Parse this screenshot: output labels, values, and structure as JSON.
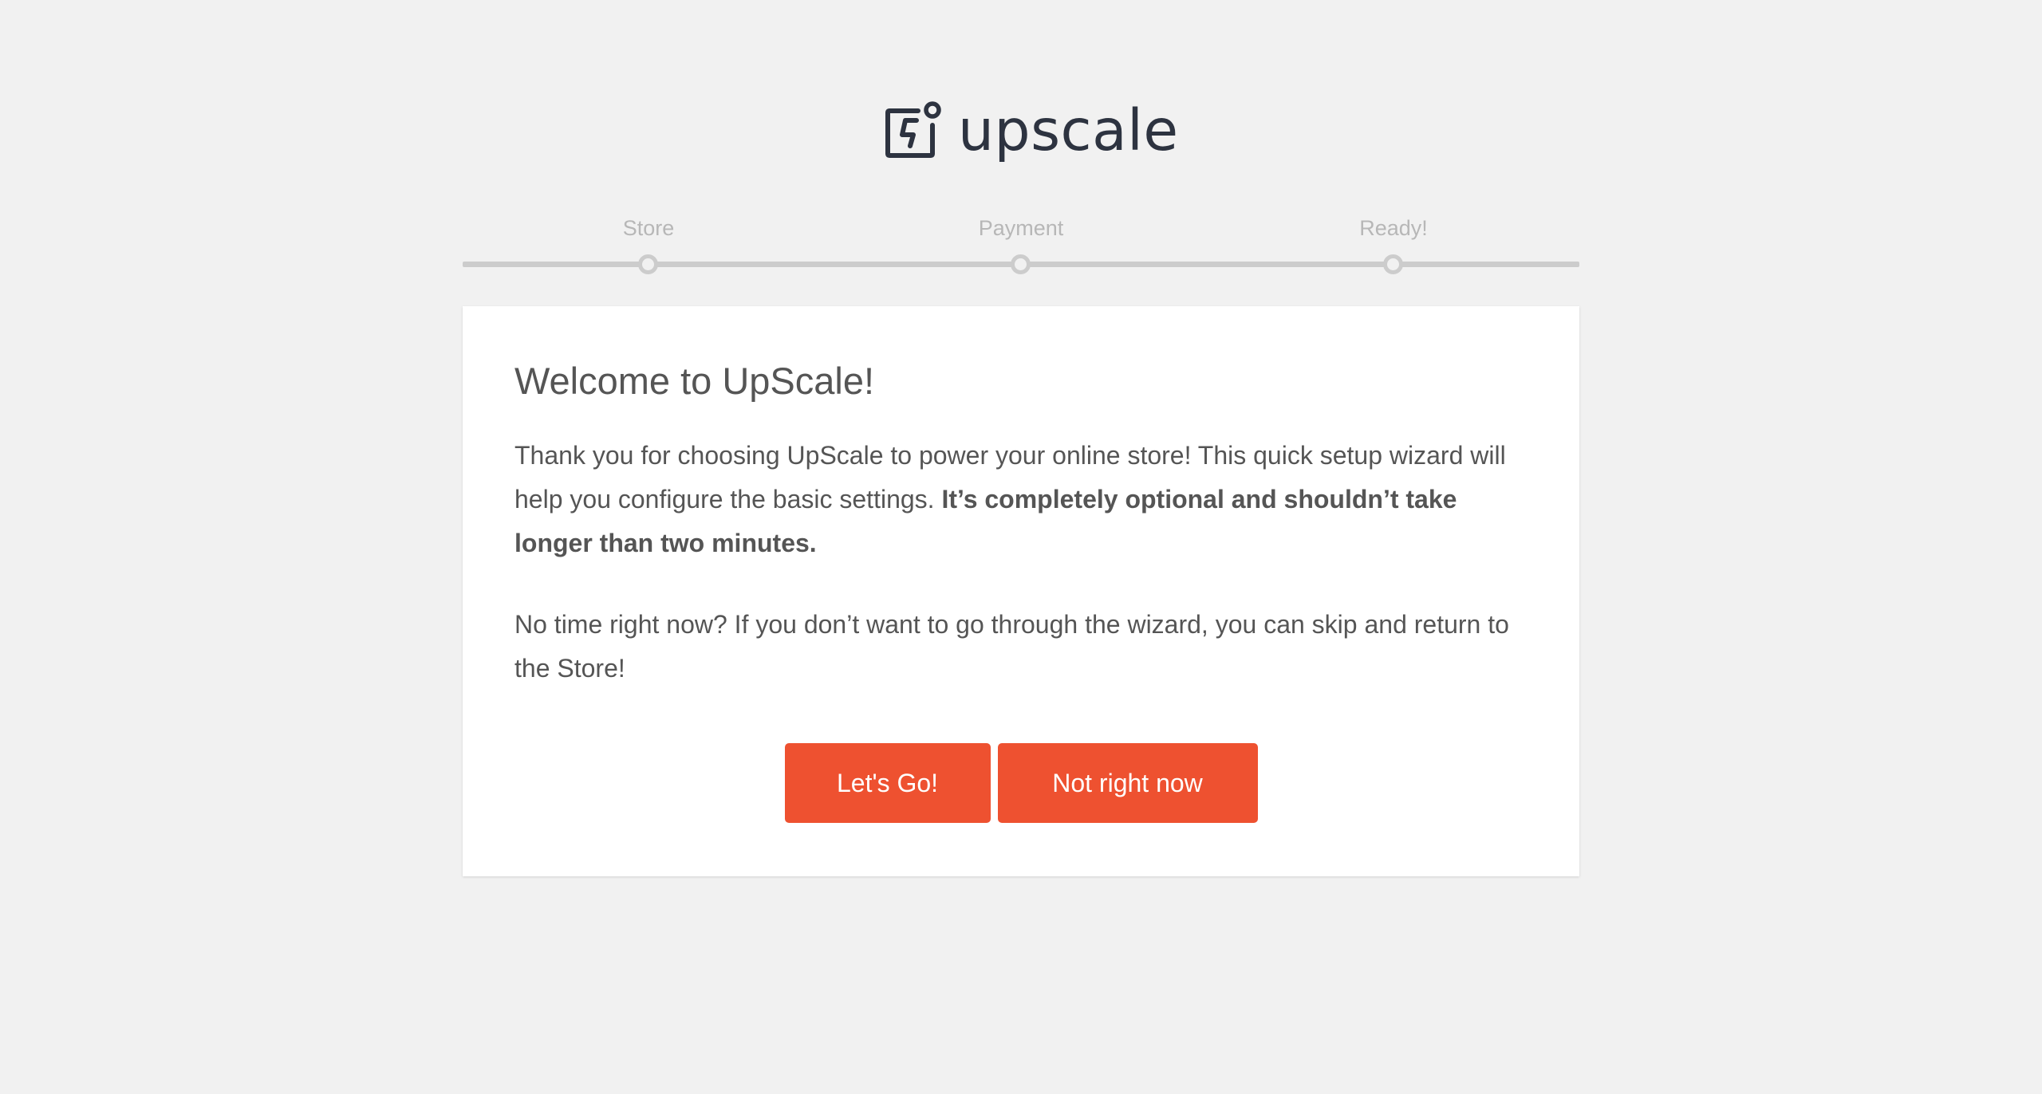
{
  "brand": {
    "name": "upscale",
    "icon": "upscale-logo-icon",
    "text_color": "#2d3340"
  },
  "steps": [
    {
      "label": "Store"
    },
    {
      "label": "Payment"
    },
    {
      "label": "Ready!"
    }
  ],
  "welcome": {
    "title": "Welcome to UpScale!",
    "intro_text": "Thank you for choosing UpScale to power your online store! This quick setup wizard will help you configure the basic settings. ",
    "intro_bold": "It’s completely optional and shouldn’t take longer than two minutes.",
    "skip_text": "No time right now? If you don’t want to go through the wizard, you can skip and return to the Store!"
  },
  "actions": {
    "primary_label": "Let's Go!",
    "secondary_label": "Not right now"
  },
  "colors": {
    "accent": "#ee5130",
    "background": "#f1f1f1",
    "card": "#ffffff",
    "text": "#555555",
    "step_inactive": "#cccccc"
  }
}
